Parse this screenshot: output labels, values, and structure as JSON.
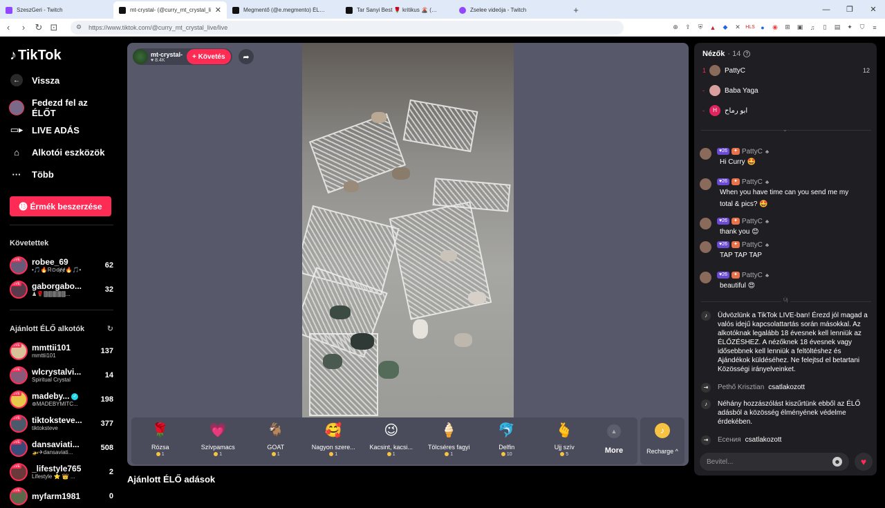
{
  "browser": {
    "tabs": [
      {
        "label": "SzeszGeri - Twitch",
        "color": "#9147ff"
      },
      {
        "label": "mt-crystal- (@curry_mt_crystal_li",
        "color": "#111111"
      },
      {
        "label": "Megmentő (@e.megmento) ÉLŐ adá",
        "color": "#111111"
      },
      {
        "label": "Tar Sanyi Best 🌹 kritikus 🌋 (@szop",
        "color": "#111111"
      },
      {
        "label": "Zselee videója - Twitch",
        "color": "#9147ff"
      }
    ],
    "url": "https://www.tiktok.com/@curry_mt_crystal_live/live"
  },
  "sidebar": {
    "logo": "TikTok",
    "nav": [
      {
        "label": "Vissza",
        "icon": "back-arrow-icon"
      },
      {
        "label": "Fedezd fel az ÉLŐT",
        "icon": "live-explore-icon"
      },
      {
        "label": "LIVE ADÁS",
        "icon": "video-camera-icon"
      },
      {
        "label": "Alkotói eszközök",
        "icon": "creator-tools-icon"
      },
      {
        "label": "Több",
        "icon": "more-dots-icon"
      }
    ],
    "coins_button": "Érmék beszerzése",
    "following_title": "Követettek",
    "following": [
      {
        "name": "robee_69",
        "sub": "•🎵🔥R⊙ʛɇɇ🔥🎵•",
        "count": "62"
      },
      {
        "name": "gaborgabo...",
        "sub": "♟🌹🀫🀫🀫🀫🀫...",
        "count": "32"
      }
    ],
    "recommended_title": "Ajánlott ÉLŐ alkotók",
    "recommended": [
      {
        "name": "mmttii101",
        "sub": "mmttii101",
        "count": "137",
        "verified": false
      },
      {
        "name": "wlcrystalvi...",
        "sub": "Spiritual Crystal",
        "count": "14",
        "verified": false
      },
      {
        "name": "madeby...",
        "sub": "⊛MADEBYMITC...",
        "count": "198",
        "verified": true
      },
      {
        "name": "tiktoksteve...",
        "sub": "tiktoksteve",
        "count": "377",
        "verified": false
      },
      {
        "name": "dansaviati...",
        "sub": "🚁✈dansaviati...",
        "count": "508",
        "verified": false
      },
      {
        "name": "_lifestyle765",
        "sub": "Lifestyle ⭐ 👑 ...",
        "count": "2",
        "verified": false
      },
      {
        "name": "myfarm1981",
        "sub": "",
        "count": "0",
        "verified": false
      }
    ]
  },
  "host": {
    "name": "mt-crystal-",
    "likes": "♥ 8.4K",
    "follow_label": "+ Követés"
  },
  "gifts": [
    {
      "name": "Rózsa",
      "price": "1",
      "icon": "🌹"
    },
    {
      "name": "Szívpamacs",
      "price": "1",
      "icon": "💗"
    },
    {
      "name": "GOAT",
      "price": "1",
      "icon": "🐐"
    },
    {
      "name": "Nagyon szere...",
      "price": "1",
      "icon": "🥰"
    },
    {
      "name": "Kacsint, kacsi...",
      "price": "1",
      "icon": "😉"
    },
    {
      "name": "Tölcséres fagyi",
      "price": "1",
      "icon": "🍦"
    },
    {
      "name": "Delfin",
      "price": "10",
      "icon": "🐬"
    },
    {
      "name": "Ujj szív",
      "price": "5",
      "icon": "🫰"
    }
  ],
  "more_label": "More",
  "recharge_label": "Recharge ^",
  "recommended_live_title": "Ajánlott ÉLŐ adások",
  "chat": {
    "viewers_title": "Nézők",
    "viewers_count": "· 14",
    "viewers": [
      {
        "rank": "1",
        "name": "PattyC",
        "score": "12",
        "color": "#8a6a5a",
        "initial": ""
      },
      {
        "rank": "-",
        "name": "Baba Yaga",
        "score": "",
        "color": "#d9a0a0",
        "initial": ""
      },
      {
        "rank": "-",
        "name": "ابو رماح",
        "score": "",
        "color": "#e0245e",
        "initial": "H"
      }
    ],
    "messages": [
      {
        "user": "PattyC",
        "level": "26",
        "text": "Hi Curry 🤩"
      },
      {
        "user": "PattyC",
        "level": "26",
        "text": "When you have time can you send me my"
      },
      {
        "user": "PattyC",
        "level": "26",
        "text": "thank you 😊"
      },
      {
        "user": "PattyC",
        "level": "26",
        "text": "TAP TAP TAP"
      },
      {
        "user": "PattyC",
        "level": "26",
        "text": "beautiful 😍"
      }
    ],
    "message_cont": "total & pics? 🤩",
    "new_label": "Új",
    "welcome": "Üdvözlünk a TikTok LIVE-ban! Érezd jól magad a valós idejű kapcsolattartás során másokkal. Az alkotóknak legalább 18 évesnek kell lenniük az ÉLŐZÉSHEZ. A nézőknek 18 évesnek vagy idősebbnek kell lenniük a feltöltéshez és Ajándékok küldéséhez. Ne felejtsd el betartani Közösségi irányelveinket.",
    "joined1_name": "Pethő Krisztian",
    "joined1_text": "csatlakozott",
    "filter_notice": "Néhány hozzászólást kiszűrtünk ebből az ÉLŐ adásból a közösség élményének védelme érdekében.",
    "joined2_name": "Есения",
    "joined2_text": "csatlakozott",
    "input_placeholder": "Bevitel..."
  },
  "colors": {
    "accent": "#fe2c55",
    "panel": "#1f1f23",
    "player": "#57596a"
  }
}
